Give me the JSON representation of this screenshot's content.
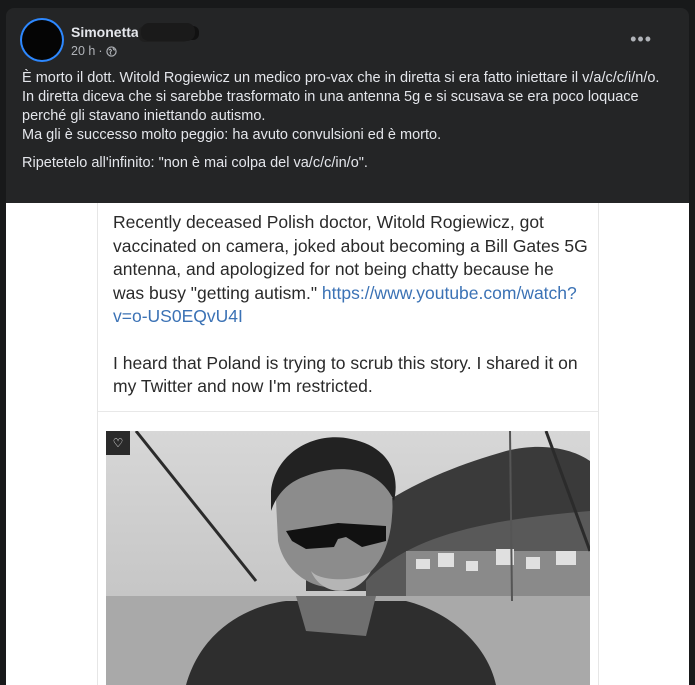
{
  "post": {
    "author": "Simonetta",
    "time": "20 h",
    "visibility_icon": "globe-icon",
    "more_icon": "more-options-icon",
    "caption": [
      "È morto il dott. Witold Rogiewicz un medico pro-vax che in diretta si era fatto iniettare il v/a/c/c/i/n/o.",
      "In diretta diceva che si sarebbe trasformato in una antenna 5g e si scusava se era poco loquace perché gli stavano iniettando autismo.",
      "Ma gli è successo molto peggio: ha avuto convulsioni ed è morto."
    ],
    "caption_last": "Ripetetelo all'infinito: \"non è mai colpa del va/c/c/in/o\"."
  },
  "image": {
    "tweet_text_1": "Recently deceased Polish doctor, Witold Rogiewicz, got vaccinated on camera, joked about becoming a Bill Gates 5G antenna, and apologized for not being chatty because he was busy \"getting autism.\" ",
    "tweet_link": "https://www.youtube.com/watch?v=o-US0EQvU4I",
    "tweet_text_2": "I heard that Poland is trying to scrub this story. I shared it on my Twitter and now I'm restricted.",
    "heart_icon": "heart-icon"
  }
}
